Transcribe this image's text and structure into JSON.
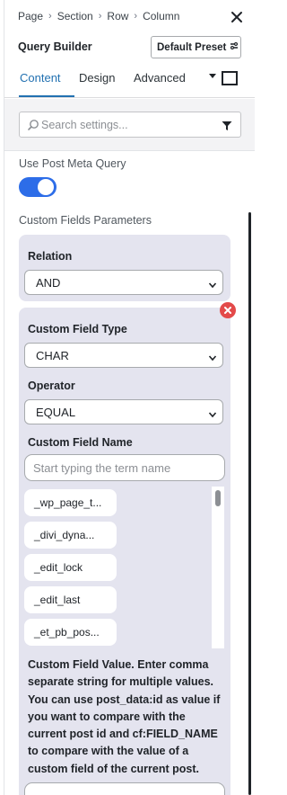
{
  "breadcrumb": [
    "Page",
    "Section",
    "Row",
    "Column"
  ],
  "header": {
    "title": "Query Builder",
    "preset_label": "Default Preset"
  },
  "tabs": [
    {
      "label": "Content",
      "active": true
    },
    {
      "label": "Design",
      "active": false
    },
    {
      "label": "Advanced",
      "active": false
    }
  ],
  "search": {
    "placeholder": "Search settings..."
  },
  "meta_query": {
    "label": "Use Post Meta Query",
    "enabled": true
  },
  "params": {
    "section_label": "Custom Fields Parameters",
    "relation": {
      "label": "Relation",
      "value": "AND"
    },
    "field": {
      "type_label": "Custom Field Type",
      "type_value": "CHAR",
      "operator_label": "Operator",
      "operator_value": "EQUAL",
      "name_label": "Custom Field Name",
      "name_placeholder": "Start typing the term name",
      "suggestions": [
        "_wp_page_t...",
        "_divi_dyna...",
        "_edit_lock",
        "_edit_last",
        "_et_pb_pos..."
      ],
      "value_description": "Custom Field Value. Enter comma separate string for multiple values. You can use post_data:id as value if you want to compare with the current post id and cf:FIELD_NAME to compare with the value of a custom field of the current post."
    }
  },
  "colors": {
    "accent": "#2271b1",
    "toggle": "#2d6de8",
    "panel": "#e4e4ef",
    "danger": "#e34a4a"
  }
}
